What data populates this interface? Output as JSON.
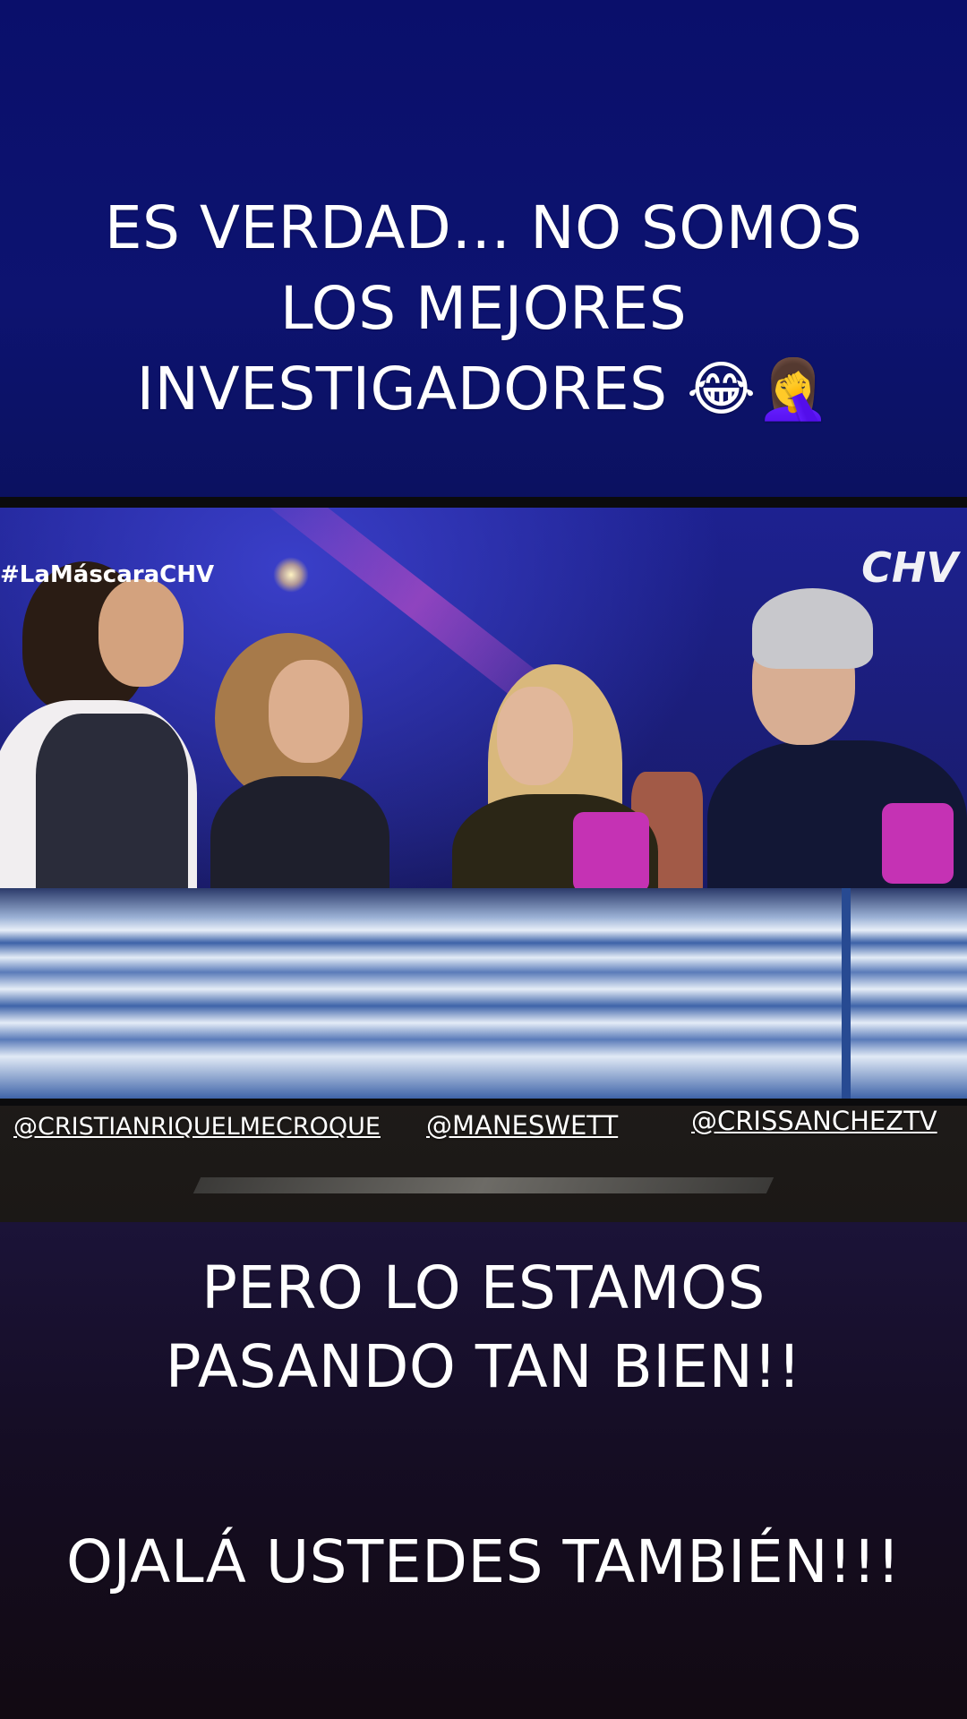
{
  "story": {
    "caption_top": [
      "ES VERDAD… NO SOMOS",
      "LOS MEJORES",
      "INVESTIGADORES 😂🤦‍♀️"
    ],
    "caption_middle": [
      "PERO LO ESTAMOS",
      "PASANDO TAN BIEN!!"
    ],
    "caption_bottom": "OJALÁ USTEDES TAMBIÉN!!!",
    "colors": {
      "top_band": "#0a0f6b",
      "bottom_band": "#150d24",
      "text": "#ffffff"
    }
  },
  "photo": {
    "tv_hashtag": "#LaMáscaraCHV",
    "tv_channel_logo": "CHV",
    "mentions": [
      "@CRISTIANRIQUELMECROQUE",
      "@MANESWETT",
      "@CRISSANCHEZTV"
    ]
  }
}
